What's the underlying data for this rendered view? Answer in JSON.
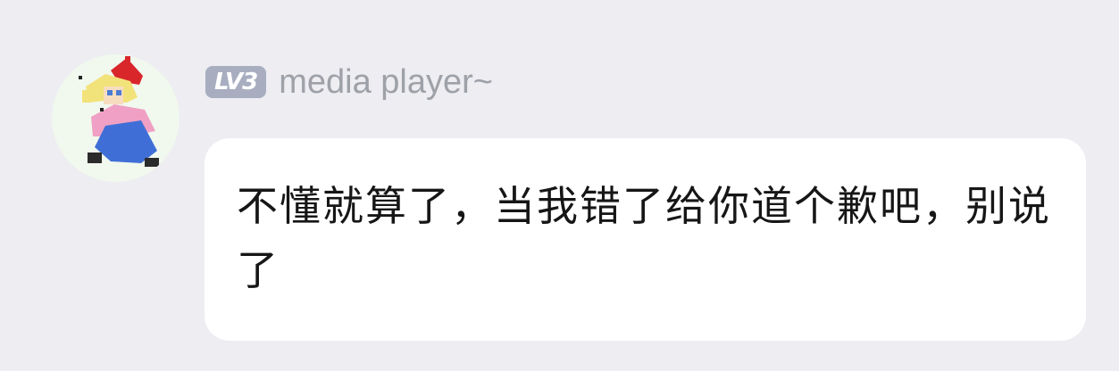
{
  "user": {
    "level": "LV3",
    "name": "media player~",
    "avatar_icon": "pixel-character-avatar-icon"
  },
  "message": {
    "text": "不懂就算了，当我错了给你道个歉吧，别说了"
  },
  "colors": {
    "background": "#ededf2",
    "bubble": "#ffffff",
    "badge": "#a8aec0",
    "username": "#9ea1a8",
    "text": "#161616"
  }
}
